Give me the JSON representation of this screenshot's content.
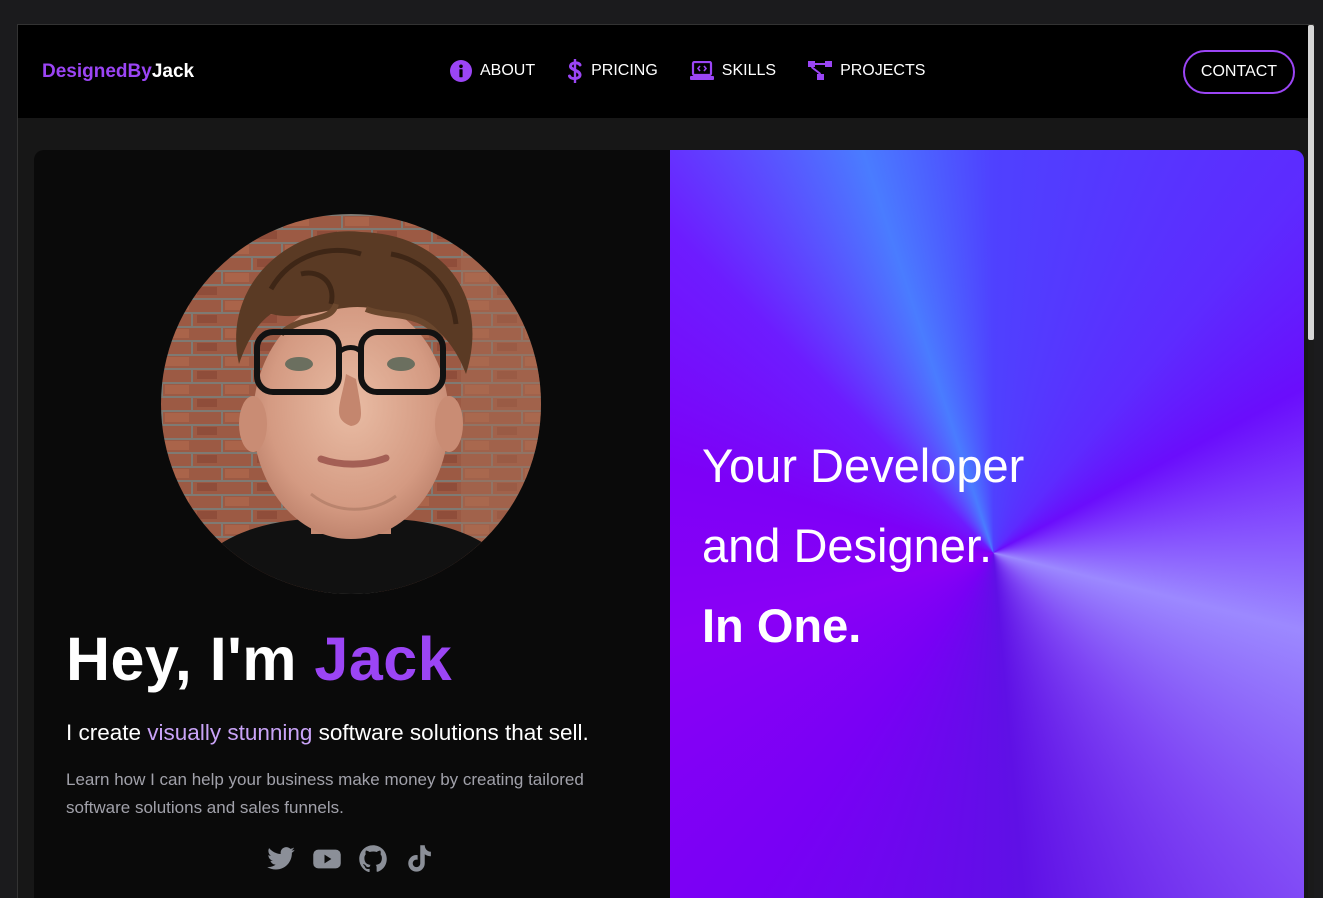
{
  "brand": {
    "prefix": "DesignedBy",
    "suffix": "Jack"
  },
  "nav": {
    "items": [
      {
        "label": "ABOUT",
        "icon": "info-circle-icon"
      },
      {
        "label": "PRICING",
        "icon": "dollar-icon"
      },
      {
        "label": "SKILLS",
        "icon": "laptop-code-icon"
      },
      {
        "label": "PROJECTS",
        "icon": "sitemap-icon"
      }
    ],
    "contact_label": "CONTACT"
  },
  "hero": {
    "greeting": "Hey, I'm ",
    "name": "Jack",
    "tagline_before": "I create ",
    "tagline_highlight": "visually stunning",
    "tagline_after": " software solutions that sell.",
    "description": "Learn how I can help your business make money by creating tailored software solutions and sales funnels.",
    "socials": [
      "twitter-icon",
      "youtube-icon",
      "github-icon",
      "tiktok-icon"
    ]
  },
  "feature": {
    "line1": "Your Developer",
    "line2": "and Designer.",
    "line3": "In One."
  },
  "colors": {
    "accent": "#9b45f5",
    "highlight": "#c9a3f7",
    "muted": "#a1a1aa",
    "social_icon": "#8b8f98"
  }
}
